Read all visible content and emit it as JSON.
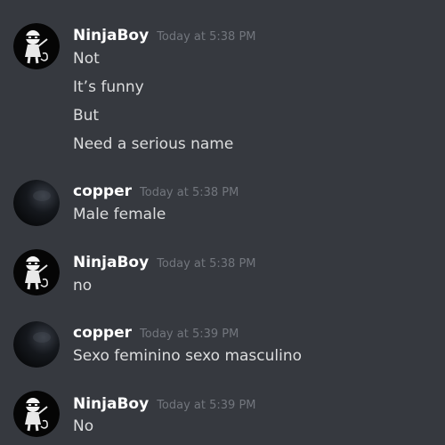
{
  "messages": [
    {
      "author": "NinjaBoy",
      "time": "Today at 5:38 PM",
      "lines": [
        "Not",
        "It’s funny",
        "But",
        "Need a serious name"
      ]
    },
    {
      "author": "copper",
      "time": "Today at 5:38 PM",
      "lines": [
        "Male female"
      ]
    },
    {
      "author": "NinjaBoy",
      "time": "Today at 5:38 PM",
      "lines": [
        "no"
      ]
    },
    {
      "author": "copper",
      "time": "Today at 5:39 PM",
      "lines": [
        "Sexo feminino sexo masculino"
      ]
    },
    {
      "author": "NinjaBoy",
      "time": "Today at 5:39 PM",
      "lines": [
        "No"
      ]
    }
  ],
  "avatars": {
    "NinjaBoy": "ninja-avatar-icon",
    "copper": "dark-sphere-avatar-icon"
  },
  "colors": {
    "background": "#36393f",
    "author": "#ffffff",
    "timestamp": "#72767d",
    "message_text": "#dcddde"
  }
}
